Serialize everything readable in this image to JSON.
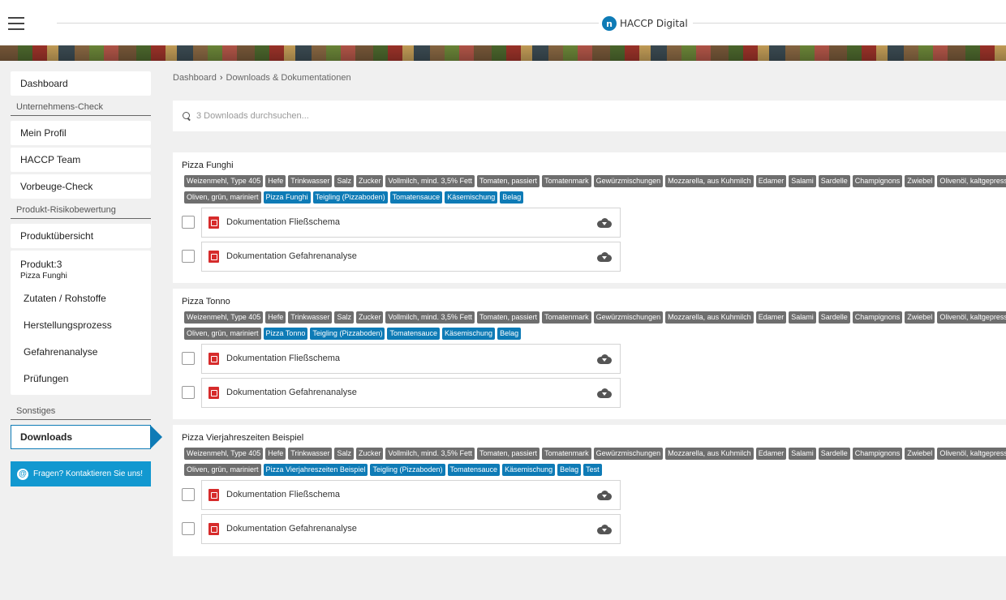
{
  "header": {
    "app_name": "HACCP Digital",
    "logo_mark": "n"
  },
  "sidebar": {
    "dashboard": "Dashboard",
    "section_company": "Unternehmens-Check",
    "mein_profil": "Mein Profil",
    "haccp_team": "HACCP Team",
    "vorbeuge_check": "Vorbeuge-Check",
    "section_product": "Produkt-Risikobewertung",
    "produktuebersicht": "Produktübersicht",
    "product_title": "Produkt:3",
    "product_name": "Pizza Funghi",
    "product_items": [
      "Zutaten / Rohstoffe",
      "Herstellungsprozess",
      "Gefahrenanalyse",
      "Prüfungen"
    ],
    "section_other": "Sonstiges",
    "downloads": "Downloads",
    "contact": "Fragen? Kontaktieren Sie uns!"
  },
  "breadcrumb": {
    "root": "Dashboard",
    "separator": "›",
    "current": "Downloads & Dokumentationen"
  },
  "search": {
    "placeholder": "3 Downloads durchsuchen..."
  },
  "documents": {
    "flow": "Dokumentation Fließschema",
    "hazard": "Dokumentation Gefahrenanalyse"
  },
  "products": [
    {
      "title": "Pizza Funghi",
      "tags": [
        {
          "t": "Weizenmehl, Type 405",
          "c": "gray"
        },
        {
          "t": "Hefe",
          "c": "gray"
        },
        {
          "t": "Trinkwasser",
          "c": "gray"
        },
        {
          "t": "Salz",
          "c": "gray"
        },
        {
          "t": "Zucker",
          "c": "gray"
        },
        {
          "t": "Vollmilch, mind. 3,5% Fett",
          "c": "gray"
        },
        {
          "t": "Tomaten, passiert",
          "c": "gray"
        },
        {
          "t": "Tomatenmark",
          "c": "gray"
        },
        {
          "t": "Gewürzmischungen",
          "c": "gray"
        },
        {
          "t": "Mozzarella, aus Kuhmilch",
          "c": "gray"
        },
        {
          "t": "Edamer",
          "c": "gray"
        },
        {
          "t": "Salami",
          "c": "gray"
        },
        {
          "t": "Sardelle",
          "c": "gray"
        },
        {
          "t": "Champignons",
          "c": "gray"
        },
        {
          "t": "Zwiebel",
          "c": "gray"
        },
        {
          "t": "Olivenöl, kaltgepresst",
          "c": "gray"
        },
        {
          "t": "Oliven, grün, mariniert",
          "c": "gray"
        },
        {
          "t": "Pizza Funghi",
          "c": "blue"
        },
        {
          "t": "Teigling (Pizzaboden)",
          "c": "blue"
        },
        {
          "t": "Tomatensauce",
          "c": "blue"
        },
        {
          "t": "Käsemischung",
          "c": "blue"
        },
        {
          "t": "Belag",
          "c": "blue"
        }
      ]
    },
    {
      "title": "Pizza Tonno",
      "tags": [
        {
          "t": "Weizenmehl, Type 405",
          "c": "gray"
        },
        {
          "t": "Hefe",
          "c": "gray"
        },
        {
          "t": "Trinkwasser",
          "c": "gray"
        },
        {
          "t": "Salz",
          "c": "gray"
        },
        {
          "t": "Zucker",
          "c": "gray"
        },
        {
          "t": "Vollmilch, mind. 3,5% Fett",
          "c": "gray"
        },
        {
          "t": "Tomaten, passiert",
          "c": "gray"
        },
        {
          "t": "Tomatenmark",
          "c": "gray"
        },
        {
          "t": "Gewürzmischungen",
          "c": "gray"
        },
        {
          "t": "Mozzarella, aus Kuhmilch",
          "c": "gray"
        },
        {
          "t": "Edamer",
          "c": "gray"
        },
        {
          "t": "Salami",
          "c": "gray"
        },
        {
          "t": "Sardelle",
          "c": "gray"
        },
        {
          "t": "Champignons",
          "c": "gray"
        },
        {
          "t": "Zwiebel",
          "c": "gray"
        },
        {
          "t": "Olivenöl, kaltgepresst",
          "c": "gray"
        },
        {
          "t": "Oliven, grün, mariniert",
          "c": "gray"
        },
        {
          "t": "Pizza Tonno",
          "c": "blue"
        },
        {
          "t": "Teigling (Pizzaboden)",
          "c": "blue"
        },
        {
          "t": "Tomatensauce",
          "c": "blue"
        },
        {
          "t": "Käsemischung",
          "c": "blue"
        },
        {
          "t": "Belag",
          "c": "blue"
        }
      ]
    },
    {
      "title": "Pizza Vierjahreszeiten Beispiel",
      "tags": [
        {
          "t": "Weizenmehl, Type 405",
          "c": "gray"
        },
        {
          "t": "Hefe",
          "c": "gray"
        },
        {
          "t": "Trinkwasser",
          "c": "gray"
        },
        {
          "t": "Salz",
          "c": "gray"
        },
        {
          "t": "Zucker",
          "c": "gray"
        },
        {
          "t": "Vollmilch, mind. 3,5% Fett",
          "c": "gray"
        },
        {
          "t": "Tomaten, passiert",
          "c": "gray"
        },
        {
          "t": "Tomatenmark",
          "c": "gray"
        },
        {
          "t": "Gewürzmischungen",
          "c": "gray"
        },
        {
          "t": "Mozzarella, aus Kuhmilch",
          "c": "gray"
        },
        {
          "t": "Edamer",
          "c": "gray"
        },
        {
          "t": "Salami",
          "c": "gray"
        },
        {
          "t": "Sardelle",
          "c": "gray"
        },
        {
          "t": "Champignons",
          "c": "gray"
        },
        {
          "t": "Zwiebel",
          "c": "gray"
        },
        {
          "t": "Olivenöl, kaltgepresst",
          "c": "gray"
        },
        {
          "t": "Oliven, grün, mariniert",
          "c": "gray"
        },
        {
          "t": "Pizza Vierjahreszeiten Beispiel",
          "c": "blue"
        },
        {
          "t": "Teigling (Pizzaboden)",
          "c": "blue"
        },
        {
          "t": "Tomatensauce",
          "c": "blue"
        },
        {
          "t": "Käsemischung",
          "c": "blue"
        },
        {
          "t": "Belag",
          "c": "blue"
        },
        {
          "t": "Test",
          "c": "blue"
        }
      ]
    }
  ],
  "colors": {
    "accent": "#0e7bb6",
    "tag_gray": "#6e6e6e",
    "contact_bg": "#1298d0",
    "pdf_red": "#d62b2b"
  }
}
